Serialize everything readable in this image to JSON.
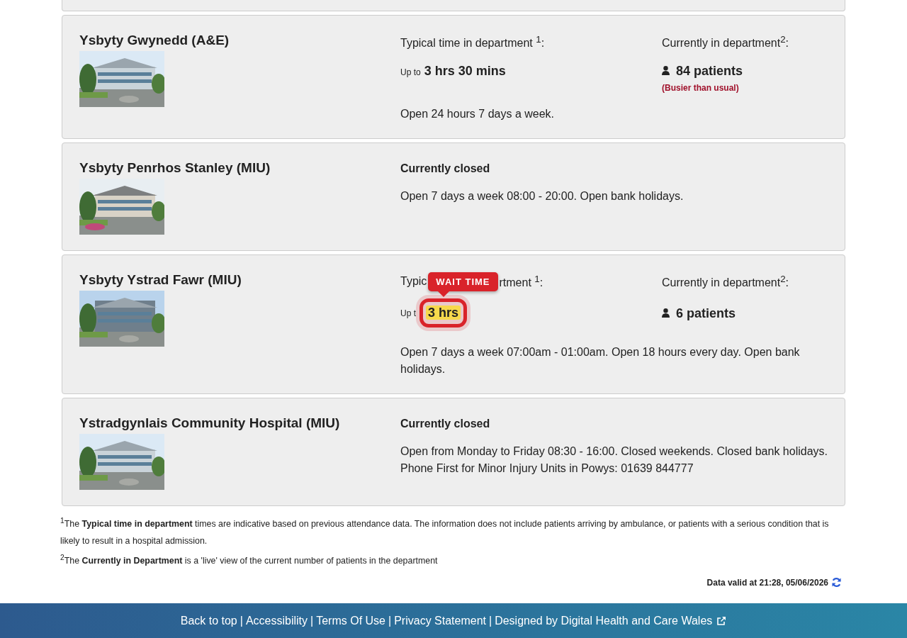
{
  "hospitals": [
    {
      "kind": "open",
      "name": "Ysbyty Gwynedd (A&E)",
      "picture": {
        "kind": "picture"
      },
      "typical_label": [
        "Typical time in department $^{1}$:"
      ],
      "up_to": "Up to",
      "typical_time": "3 hrs 30 mins",
      "current_label": "Currently in department$^{2}$:",
      "patients": "84 patients",
      "busy_note": "(Busier than usual)",
      "hours": "Open 24 hours 7 days a week."
    },
    {
      "kind": "closed",
      "name": "Ysbyty Penrhos Stanley (MIU)",
      "picture": {
        "kind": "picture"
      },
      "status": "Currently closed",
      "hours": "Open 7 days a week 08:00 - 20:00. Open bank holidays."
    },
    {
      "kind": "open",
      "name": "Ysbyty Ystrad Fawr (MIU)",
      "picture": {
        "kind": "picture"
      },
      "typical_label": [
        "Typic",
        "rtment $^{1}$:"
      ],
      "up_to": "Up t",
      "typical_time": "3 hrs",
      "annotation": "WAIT TIME",
      "current_label": "Currently in department$^{2}$:",
      "patients": "6 patients",
      "hours": "Open 7 days a week 07:00am - 01:00am. Open 18 hours every day. Open bank holidays."
    },
    {
      "kind": "closed",
      "name": "Ystradgynlais Community Hospital (MIU)",
      "picture": {
        "kind": "picture"
      },
      "status": "Currently closed",
      "hours": "Open from Monday to Friday 08:30 - 16:00. Closed weekends. Closed bank holidays.",
      "phone": "Phone First for Minor Injury Units in Powys: 01639 844777"
    }
  ],
  "footnotes": [
    "$^{1}$The **Typical time in department** times are indicative based on previous attendance data. The information does not include patients arriving by ambulance, or patients with a serious condition that is likely to result in a hospital admission.",
    "$^{2}$The **Currently in Department** is a 'live' view of the current number of patients in the department"
  ],
  "data_valid": "Data valid at 21:28, 05/06/2026",
  "footer_links": [
    {
      "label": "Back to top",
      "external": false
    },
    {
      "label": "Accessibility",
      "external": false
    },
    {
      "label": "Terms Of Use",
      "external": false
    },
    {
      "label": "Privacy Statement",
      "external": false
    },
    {
      "label": "Designed by Digital Health and Care Wales",
      "external": true
    }
  ],
  "footer_separator": "|"
}
